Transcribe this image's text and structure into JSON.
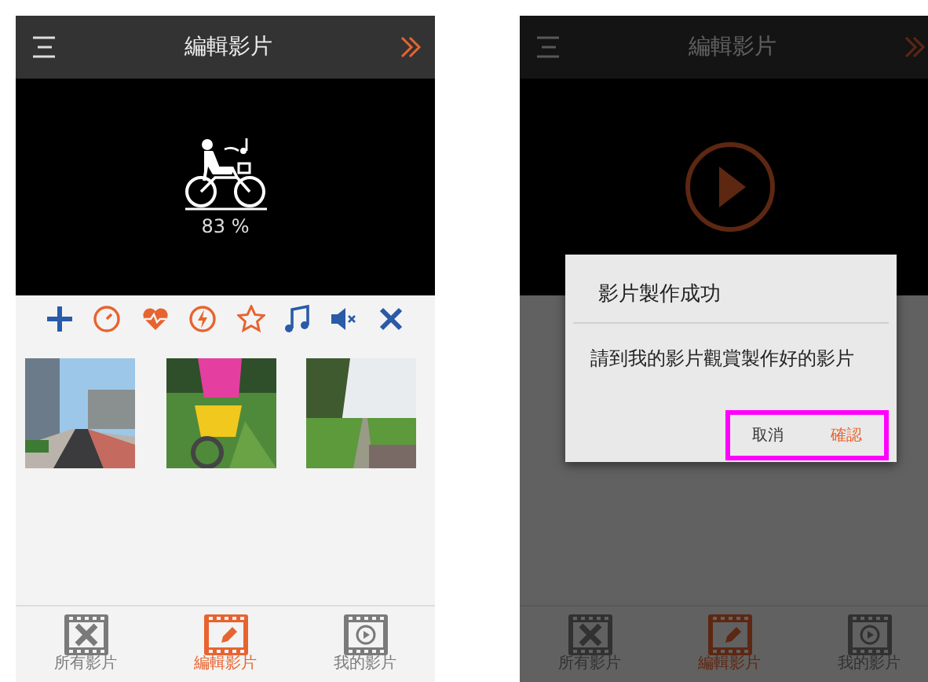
{
  "screens": [
    {
      "title": "編輯影片",
      "dimmed": false,
      "preview": {
        "kind": "progress",
        "reading": "83 %"
      },
      "toolbar": true,
      "tabs": [
        {
          "label": "所有影片",
          "selected": false
        },
        {
          "label": "編輯影片",
          "selected": true
        },
        {
          "label": "我的影片",
          "selected": false
        }
      ]
    },
    {
      "title": "編輯影片",
      "dimmed": true,
      "preview": {
        "kind": "play"
      },
      "toolbar": false,
      "tabs": [
        {
          "label": "所有影片",
          "selected": false
        },
        {
          "label": "編輯影片",
          "selected": true
        },
        {
          "label": "我的影片",
          "selected": false
        }
      ],
      "dialog": {
        "title": "影片製作成功",
        "message": "請到我的影片觀賞製作好的影片",
        "actions_highlighted": true,
        "buttons": [
          {
            "label": "取消",
            "kind": "cancel"
          },
          {
            "label": "確認",
            "kind": "confirm"
          }
        ]
      }
    }
  ]
}
